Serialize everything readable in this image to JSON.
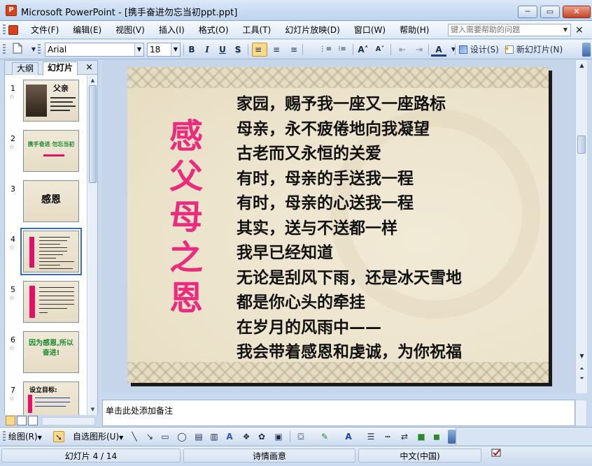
{
  "window": {
    "title": "Microsoft PowerPoint - [携手奋进勿忘当初ppt.ppt]",
    "app_icon_glyph": "P",
    "minimize_glyph": "─",
    "restore_glyph": "▭",
    "close_glyph": "✕"
  },
  "menu": {
    "items": [
      "文件(F)",
      "编辑(E)",
      "视图(V)",
      "插入(I)",
      "格式(O)",
      "工具(T)",
      "幻灯片放映(D)",
      "窗口(W)",
      "帮助(H)"
    ],
    "help_placeholder": "键入需要帮助的问题",
    "close_glyph": "×"
  },
  "toolbar": {
    "font": "Arial",
    "font_size": "18",
    "bold": "B",
    "italic": "I",
    "underline": "U",
    "shadow": "S",
    "align_left": "≡",
    "align_center": "≡",
    "align_right": "≡",
    "numbering": "⋮≡",
    "bullets": "⁝≡",
    "grow_font": "A˄",
    "shrink_font": "A˅",
    "decrease_indent": "⇤",
    "increase_indent": "⇥",
    "font_color": "A",
    "design_label": "设计(S)",
    "new_slide_label": "新幻灯片(N)"
  },
  "left_panel": {
    "tab_outline": "大纲",
    "tab_slides": "幻灯片",
    "close_glyph": "×",
    "thumbnails": [
      {
        "num": "1",
        "title": "父亲"
      },
      {
        "num": "2",
        "title": "携手奋进  勿忘当初"
      },
      {
        "num": "3",
        "title": "感恩"
      },
      {
        "num": "4",
        "title": ""
      },
      {
        "num": "5",
        "title": ""
      },
      {
        "num": "6",
        "title": "因为感恩,所以奋进!"
      },
      {
        "num": "7",
        "title": "设立目标:"
      }
    ],
    "star_glyph": "☆"
  },
  "slide": {
    "vertical_title": [
      "感",
      "父",
      "母",
      "之",
      "恩"
    ],
    "lines": [
      "家园，赐予我一座又一座路标",
      "母亲，永不疲倦地向我凝望",
      "古老而又永恒的关爱",
      "有时，母亲的手送我一程",
      "有时，母亲的心送我一程",
      "其实，送与不送都一样",
      "我早已经知道",
      "无论是刮风下雨，还是冰天雪地",
      "都是你心头的牵挂",
      "在岁月的风雨中——",
      "我会带着感恩和虔诚，为你祝福"
    ]
  },
  "notes": {
    "placeholder": "单击此处添加备注"
  },
  "drawing_toolbar": {
    "draw_label": "绘图(R)",
    "autoshapes_label": "自选图形(U)"
  },
  "status": {
    "slide_info": "幻灯片 4 / 14",
    "design_name": "诗情画意",
    "language": "中文(中国)"
  },
  "colors": {
    "title_pink": "#ec2b7e",
    "accent_blue": "#3d6bb3"
  }
}
